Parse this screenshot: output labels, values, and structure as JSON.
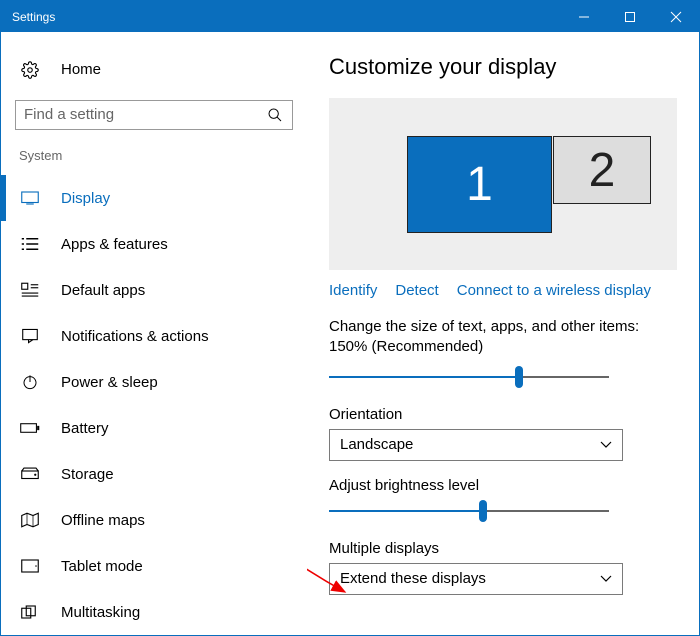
{
  "titlebar": {
    "title": "Settings"
  },
  "sidebar": {
    "home_label": "Home",
    "search_placeholder": "Find a setting",
    "category_label": "System",
    "items": [
      {
        "label": "Display"
      },
      {
        "label": "Apps & features"
      },
      {
        "label": "Default apps"
      },
      {
        "label": "Notifications & actions"
      },
      {
        "label": "Power & sleep"
      },
      {
        "label": "Battery"
      },
      {
        "label": "Storage"
      },
      {
        "label": "Offline maps"
      },
      {
        "label": "Tablet mode"
      },
      {
        "label": "Multitasking"
      }
    ]
  },
  "main": {
    "title": "Customize your display",
    "monitor1": "1",
    "monitor2": "2",
    "identify": "Identify",
    "detect": "Detect",
    "connect_wireless": "Connect to a wireless display",
    "scale_text": "Change the size of text, apps, and other items: 150% (Recommended)",
    "orientation_label": "Orientation",
    "orientation_value": "Landscape",
    "brightness_label": "Adjust brightness level",
    "multiple_label": "Multiple displays",
    "multiple_value": "Extend these displays",
    "scale_slider_pct": 68,
    "brightness_slider_pct": 55
  }
}
